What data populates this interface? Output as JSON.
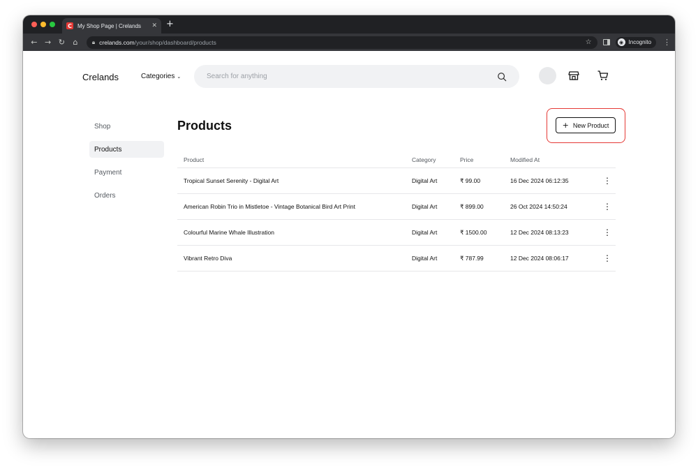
{
  "browser": {
    "tab_title": "My Shop Page | Crelands",
    "favicon_letter": "C",
    "url_host": "crelands.com",
    "url_path": "/your/shop/dashboard/products",
    "incognito_label": "Incognito"
  },
  "header": {
    "logo": "Crelands",
    "categories_label": "Categories",
    "search_placeholder": "Search for anything"
  },
  "sidebar": {
    "items": [
      {
        "label": "Shop",
        "active": false
      },
      {
        "label": "Products",
        "active": true
      },
      {
        "label": "Payment",
        "active": false
      },
      {
        "label": "Orders",
        "active": false
      }
    ]
  },
  "main": {
    "title": "Products",
    "new_button_label": "New Product",
    "highlight_color": "#e53935",
    "columns": [
      "Product",
      "Category",
      "Price",
      "Modified At"
    ],
    "rows": [
      {
        "product": "Tropical Sunset Serenity - Digital Art",
        "category": "Digital Art",
        "price": "₹ 99.00",
        "modified": "16 Dec 2024 06:12:35"
      },
      {
        "product": "American Robin Trio in Mistletoe - Vintage Botanical Bird Art Print",
        "category": "Digital Art",
        "price": "₹ 899.00",
        "modified": "26 Oct 2024 14:50:24"
      },
      {
        "product": "Colourful Marine Whale Illustration",
        "category": "Digital Art",
        "price": "₹ 1500.00",
        "modified": "12 Dec 2024 08:13:23"
      },
      {
        "product": "Vibrant Retro Diva",
        "category": "Digital Art",
        "price": "₹ 787.99",
        "modified": "12 Dec 2024 08:06:17"
      }
    ]
  }
}
